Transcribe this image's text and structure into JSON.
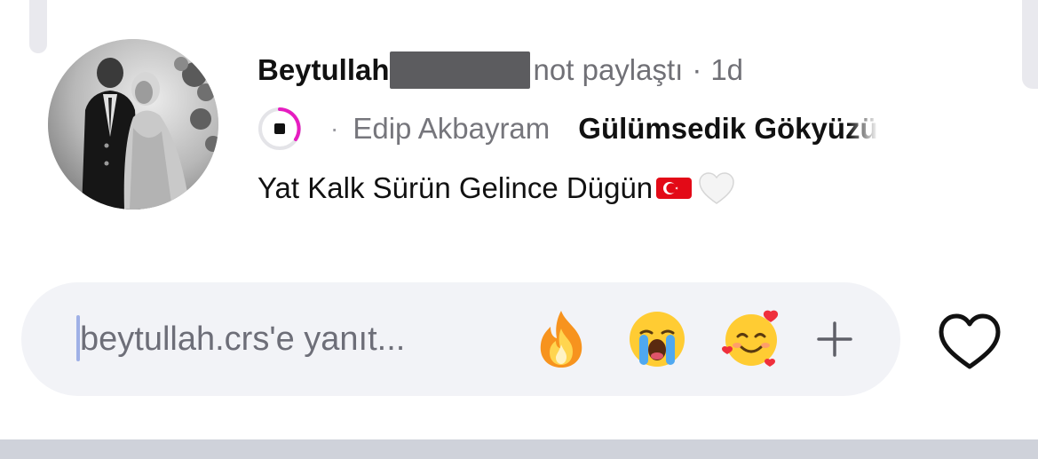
{
  "note": {
    "username": "Beytullah",
    "action": "not paylaştı",
    "timestamp": "1d",
    "music": {
      "artist": "Edip Akbayram",
      "song": "Gülümsedik Gökyüzü"
    },
    "text": "Yat Kalk Sürün Gelince Dügün"
  },
  "reply": {
    "placeholder": "beytullah.crs'e yanıt..."
  },
  "colors": {
    "accent_ring": "#e61cc0",
    "background": "#ffffff",
    "input_bg": "#f2f3f7"
  },
  "icons": {
    "quick_reactions": [
      "fire-emoji",
      "loudly-crying-emoji",
      "smiling-face-with-hearts-emoji"
    ],
    "add": "plus-icon",
    "like": "heart-outline-icon",
    "note_emojis": [
      "turkey-flag-emoji",
      "white-heart-emoji"
    ]
  }
}
